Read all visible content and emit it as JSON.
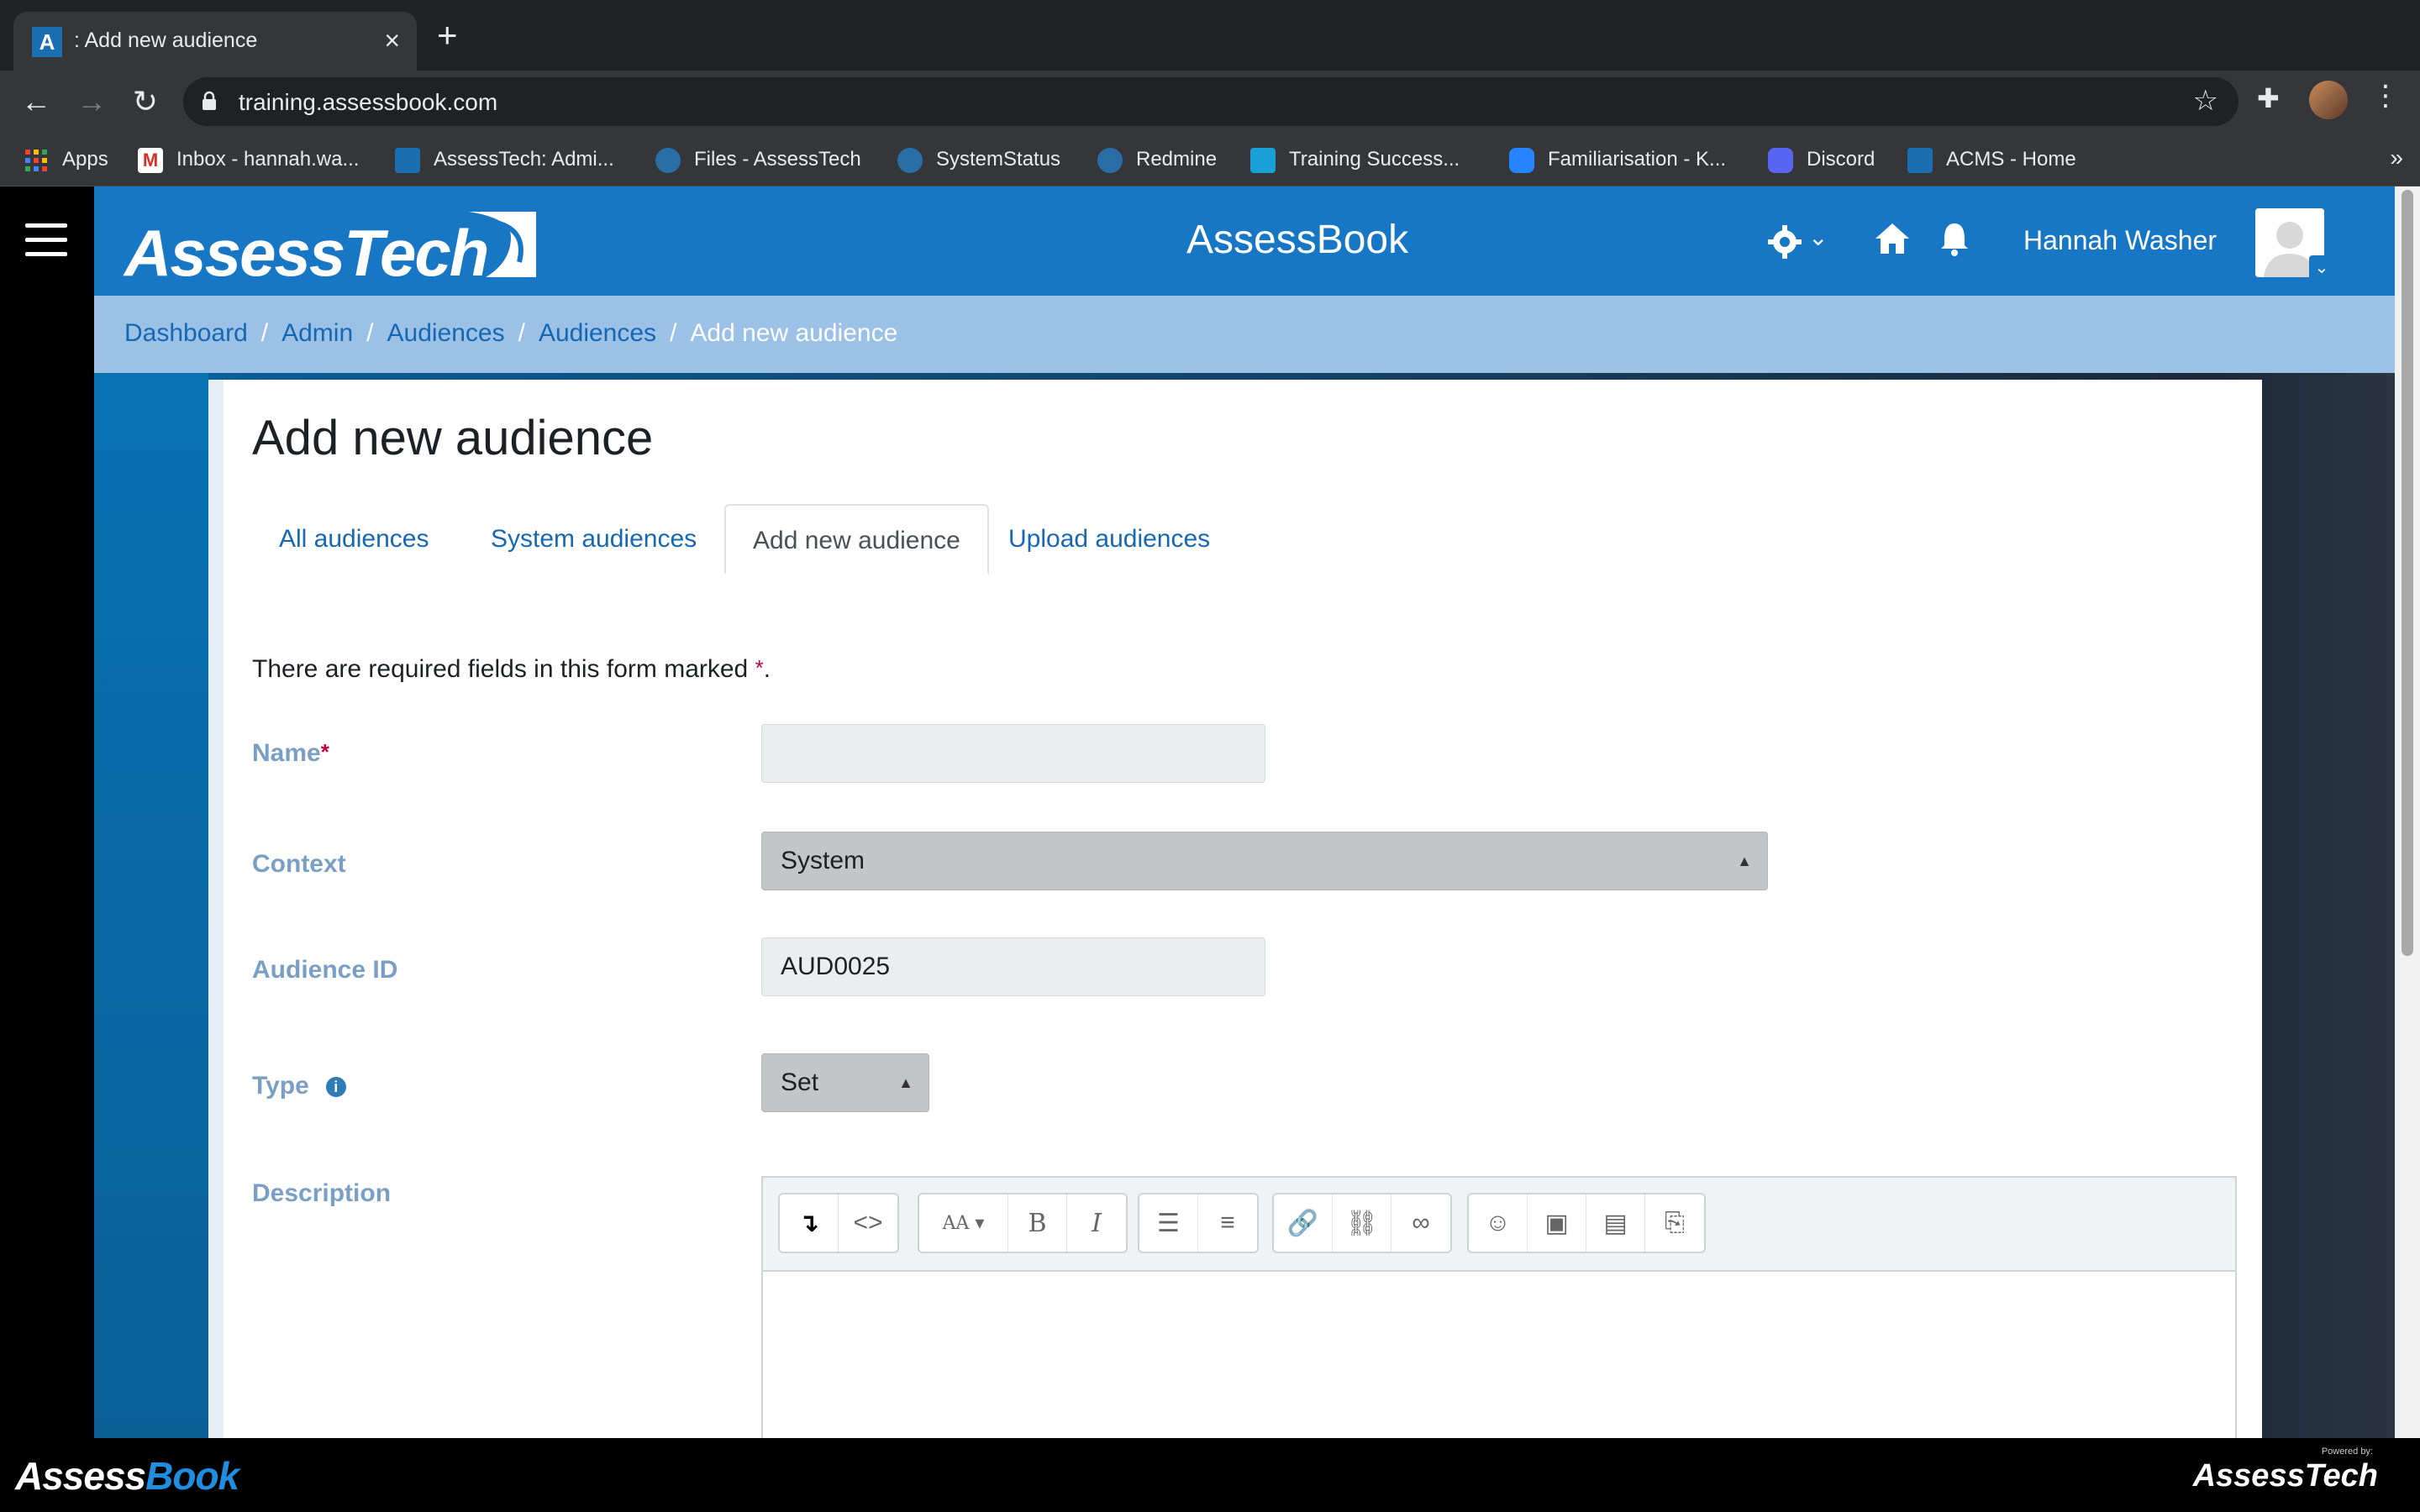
{
  "browser": {
    "tab_title": ": Add new audience",
    "url": "training.assessbook.com",
    "bookmarks": [
      {
        "label": "Apps",
        "icon": "apps-grid-icon"
      },
      {
        "label": "Inbox - hannah.wa...",
        "icon": "gmail-icon"
      },
      {
        "label": "AssessTech: Admi...",
        "icon": "assesstech-icon"
      },
      {
        "label": "Files - AssessTech",
        "icon": "assesstech-icon"
      },
      {
        "label": "SystemStatus",
        "icon": "assesstech-icon"
      },
      {
        "label": "Redmine",
        "icon": "assesstech-icon"
      },
      {
        "label": "Training Success...",
        "icon": "training-icon"
      },
      {
        "label": "Familiarisation - K...",
        "icon": "confluence-icon"
      },
      {
        "label": "Discord",
        "icon": "discord-icon"
      },
      {
        "label": "ACMS - Home",
        "icon": "assesstech-icon"
      }
    ],
    "more_bookmarks": "»"
  },
  "header": {
    "logo_text": "AssessTech",
    "site_title": "AssessBook",
    "user_name": "Hannah Washer"
  },
  "breadcrumb": {
    "items": [
      "Dashboard",
      "Admin",
      "Audiences",
      "Audiences"
    ],
    "current": "Add new audience"
  },
  "page": {
    "title": "Add new audience",
    "tabs": [
      {
        "label": "All audiences",
        "active": false
      },
      {
        "label": "System audiences",
        "active": false
      },
      {
        "label": "Add new audience",
        "active": true
      },
      {
        "label": "Upload audiences",
        "active": false
      }
    ],
    "required_note": "There are required fields in this form marked",
    "required_mark": "*",
    "required_end": "."
  },
  "form": {
    "name_label": "Name",
    "name_value": "",
    "context_label": "Context",
    "context_value": "System",
    "audience_id_label": "Audience ID",
    "audience_id_value": "AUD0025",
    "type_label": "Type",
    "type_value": "Set",
    "description_label": "Description"
  },
  "footer": {
    "logo_a": "Assess",
    "logo_b": "Book",
    "powered_label": "Powered by:",
    "powered_logo": "AssessTech"
  },
  "colors": {
    "header_blue": "#1777c4",
    "breadcrumb_bg": "#9bc1e6",
    "link_blue": "#1668b2",
    "label_blue": "#7a9fc4",
    "required_red": "#c1003b"
  }
}
